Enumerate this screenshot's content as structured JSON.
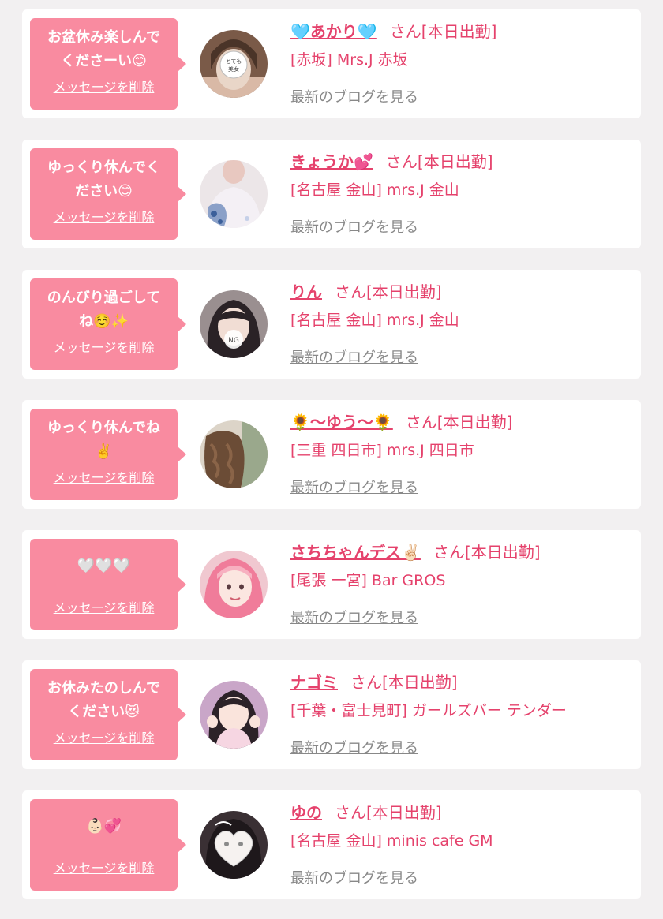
{
  "delete_label": "メッセージを削除",
  "blog_label": "最新のブログを見る",
  "colors": {
    "bubble": "#f98ba0",
    "accent": "#e5426c",
    "link_gray": "#888888",
    "background": "#f2f0f1"
  },
  "cards": [
    {
      "message": "お盆休み楽しんで\nくださーい😊",
      "name": "🩵あかり🩵",
      "status": "さん[本日出勤]",
      "shop": "[赤坂] Mrs.J 赤坂",
      "avatar_icon": "woman-photo-blurred-face"
    },
    {
      "message": "ゆっくり休んでく\nださい😊",
      "name": "きょうか💕",
      "status": "さん[本日出勤]",
      "shop": "[名古屋 金山] mrs.J 金山",
      "avatar_icon": "woman-photo-blouse"
    },
    {
      "message": "のんびり過ごして\nね☺️✨",
      "name": "りん",
      "status": "さん[本日出勤]",
      "shop": "[名古屋 金山] mrs.J 金山",
      "avatar_icon": "woman-photo-dark-hair"
    },
    {
      "message": "ゆっくり休んでね\n✌️",
      "name": "🌻〜ゆう〜🌻",
      "status": "さん[本日出勤]",
      "shop": "[三重 四日市] mrs.J 四日市",
      "avatar_icon": "woman-photo-wavy-hair"
    },
    {
      "message": "🤍🤍🤍",
      "name": "さちちゃんデス✌🏻",
      "status": "さん[本日出勤]",
      "shop": "[尾張 一宮] Bar GROS",
      "avatar_icon": "woman-photo-pink-hair"
    },
    {
      "message": "お休みたのしんで\nください😻",
      "name": "ナゴミ",
      "status": "さん[本日出勤]",
      "shop": "[千葉・富士見町] ガールズバー テンダー",
      "avatar_icon": "woman-photo-peace-pose"
    },
    {
      "message": "👶🏻💞",
      "name": "ゆの",
      "status": "さん[本日出勤]",
      "shop": "[名古屋 金山] minis cafe GM",
      "avatar_icon": "woman-photo-heart-mask"
    }
  ]
}
